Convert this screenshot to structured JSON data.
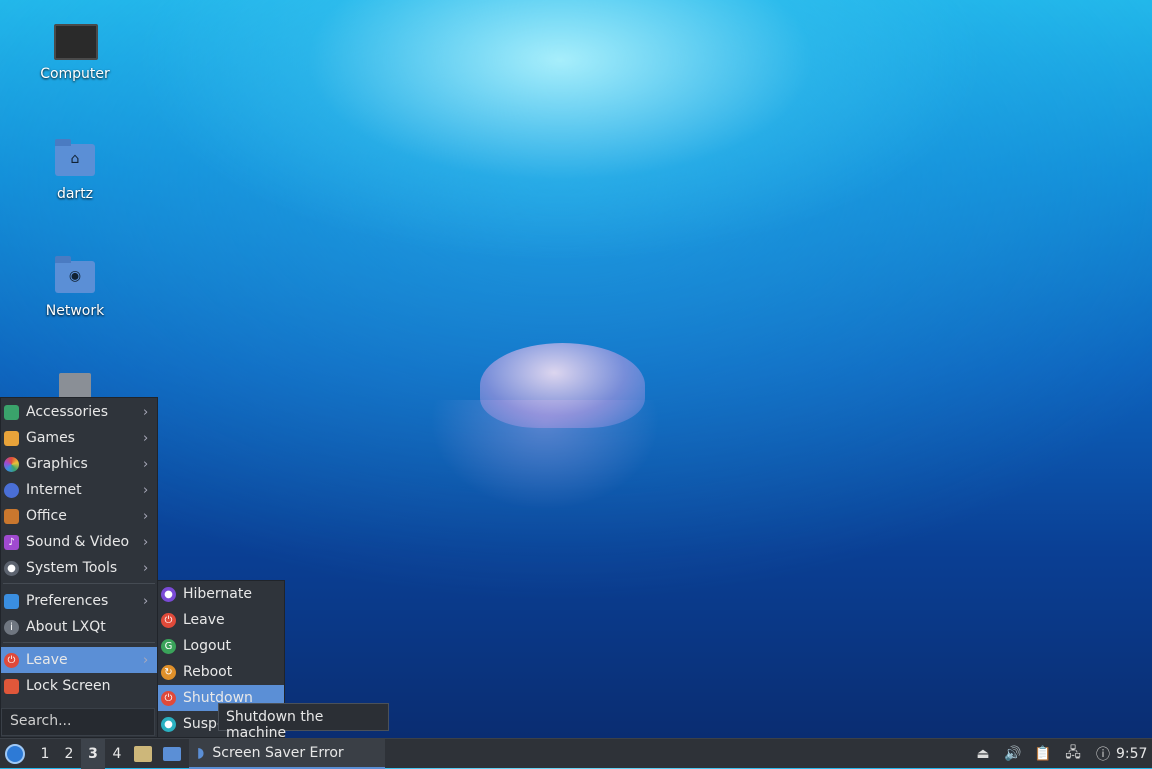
{
  "desktop": {
    "icons": [
      {
        "label": "Computer",
        "icon": "computer-icon"
      },
      {
        "label": "dartz",
        "icon": "home-folder-icon"
      },
      {
        "label": "Network",
        "icon": "network-folder-icon"
      },
      {
        "label": "",
        "icon": "trash-icon"
      }
    ]
  },
  "menu": {
    "items": [
      {
        "label": "Accessories",
        "icon": "accessories-icon",
        "color": "#3aa36b"
      },
      {
        "label": "Games",
        "icon": "games-icon",
        "color": "#e8a33a"
      },
      {
        "label": "Graphics",
        "icon": "graphics-icon",
        "color": "#d74a8a"
      },
      {
        "label": "Internet",
        "icon": "internet-icon",
        "color": "#4a6fd6"
      },
      {
        "label": "Office",
        "icon": "office-icon",
        "color": "#c9772e"
      },
      {
        "label": "Sound & Video",
        "icon": "sound-video-icon",
        "color": "#a04ad0"
      },
      {
        "label": "System Tools",
        "icon": "system-tools-icon",
        "color": "#5d6470"
      },
      {
        "label": "Preferences",
        "icon": "preferences-icon",
        "color": "#3a8ee0"
      },
      {
        "label": "About LXQt",
        "icon": "about-icon",
        "color": "#6f7680"
      },
      {
        "label": "Leave",
        "icon": "leave-icon",
        "color": "#e04a3a"
      },
      {
        "label": "Lock Screen",
        "icon": "lock-icon",
        "color": "#e0573a"
      }
    ],
    "search_placeholder": "Search..."
  },
  "leave_submenu": {
    "items": [
      {
        "label": "Hibernate",
        "icon": "hibernate-icon",
        "color": "#7a4ad6"
      },
      {
        "label": "Leave",
        "icon": "leave-icon",
        "color": "#e04a3a"
      },
      {
        "label": "Logout",
        "icon": "logout-icon",
        "color": "#3aa35a"
      },
      {
        "label": "Reboot",
        "icon": "reboot-icon",
        "color": "#e0902a"
      },
      {
        "label": "Shutdown",
        "icon": "shutdown-icon",
        "color": "#e04a3a"
      },
      {
        "label": "Suspe",
        "icon": "suspend-icon",
        "color": "#2ab0c0"
      }
    ]
  },
  "tooltip": "Shutdown the machine",
  "taskbar": {
    "workspaces": [
      "1",
      "2",
      "3",
      "4"
    ],
    "current_workspace": "3",
    "task_label": "Screen Saver Error",
    "clock": "9:57"
  },
  "colors": {
    "accent": "#5b8fd6",
    "panel": "#2e3238"
  }
}
